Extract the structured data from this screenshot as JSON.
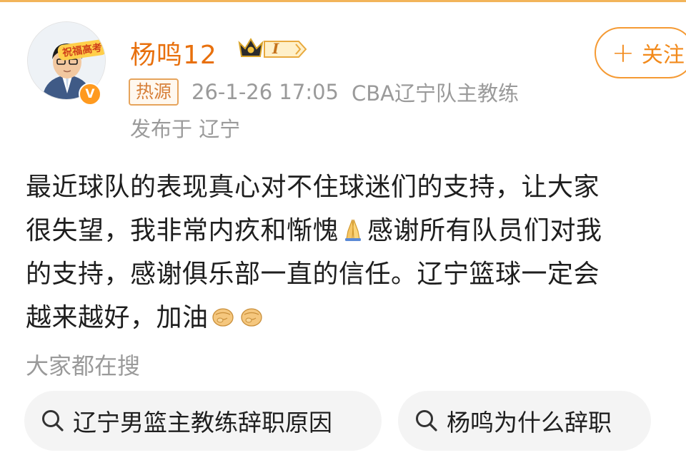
{
  "user": {
    "avatar_badge": "祝福高考",
    "verified_mark": "V",
    "name": "杨鸣12",
    "level": "I"
  },
  "follow_button": {
    "plus": "+",
    "label": "关注"
  },
  "meta": {
    "hot_badge": "热源",
    "timestamp": "26-1-26 17:05",
    "description": "CBA辽宁队主教练",
    "location": "发布于 辽宁"
  },
  "post": {
    "line1": "最近球队的表现真心对不住球迷们的支持，让大家",
    "line2_a": "很失望，我非常内疚和惭愧",
    "line2_b": "感谢所有队员们对我",
    "line3": "的支持，感谢俱乐部一直的信任。辽宁篮球一定会",
    "line4": "越来越好，加油",
    "emojis": [
      "praying-hands-emoji",
      "fist-emoji",
      "fist-emoji"
    ]
  },
  "search_section": {
    "title": "大家都在搜",
    "items": [
      "辽宁男篮主教练辞职原因",
      "杨鸣为什么辞职"
    ]
  },
  "colors": {
    "accent": "#f28a1b",
    "username": "#e8700d",
    "muted": "#9a9a9a"
  }
}
